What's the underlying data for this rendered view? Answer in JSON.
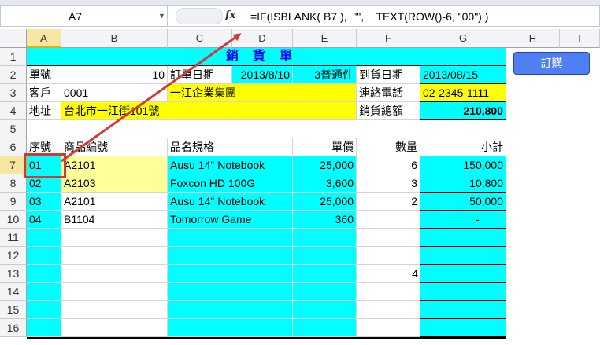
{
  "formula_bar": {
    "name_box": "A7",
    "fx_label": "fx",
    "formula": "=IF(ISBLANK( B7 ),  \"\",    TEXT(ROW()-6, \"00\") )"
  },
  "columns": [
    "A",
    "B",
    "C",
    "D",
    "E",
    "F",
    "G",
    "H",
    "I"
  ],
  "rows": [
    "1",
    "2",
    "3",
    "4",
    "5",
    "6",
    "7",
    "8",
    "9",
    "10",
    "11",
    "12",
    "13",
    "14",
    "15",
    "16"
  ],
  "order_button": "訂購",
  "cells": {
    "title": "銷貨單",
    "r2": {
      "a": "單號",
      "b": "10",
      "c": "訂單日期",
      "d": "2013/8/10",
      "e": "3普通件",
      "f": "到貨日期",
      "g": "2013/08/15"
    },
    "r3": {
      "a": "客戶",
      "b": "0001",
      "c": "一江企業集團",
      "f": "連絡電話",
      "g": "02-2345-1111"
    },
    "r4": {
      "a": "地址",
      "b": "台北市一江街101號",
      "f": "銷貨總額",
      "g": "210,800"
    },
    "r6": {
      "a": "序號",
      "b": "商品編號",
      "c": "品名規格",
      "e": "單價",
      "f": "數量",
      "g": "小計"
    },
    "items": [
      {
        "seq": "01",
        "code": "A2101",
        "name": "Ausu 14\" Notebook",
        "price": "25,000",
        "qty": "6",
        "sub": "150,000"
      },
      {
        "seq": "02",
        "code": "A2103",
        "name": "Foxcon HD 100G",
        "price": "3,600",
        "qty": "3",
        "sub": "10,800"
      },
      {
        "seq": "03",
        "code": "A2101",
        "name": "Ausu 14\" Notebook",
        "price": "25,000",
        "qty": "2",
        "sub": "50,000"
      },
      {
        "seq": "04",
        "code": "B1104",
        "name": "Tomorrow Game",
        "price": "360",
        "qty": "",
        "sub": "-"
      }
    ],
    "r13_qty": "4"
  },
  "colors": {
    "cyan": "#00ffff",
    "yellow": "#ffff00",
    "light_yellow": "#ffff99",
    "title_blue": "#0000ff",
    "arrow_red": "#d03a3a"
  }
}
